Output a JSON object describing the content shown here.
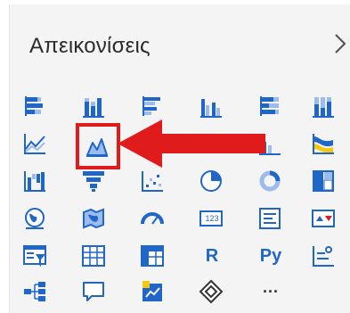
{
  "pane": {
    "title": "Απεικονίσεις",
    "collapse_glyph": ">"
  },
  "icons": [
    {
      "name": "stacked-bar-chart-icon"
    },
    {
      "name": "stacked-column-chart-icon"
    },
    {
      "name": "clustered-bar-chart-icon"
    },
    {
      "name": "clustered-column-chart-icon"
    },
    {
      "name": "100-percent-stacked-bar-chart-icon"
    },
    {
      "name": "100-percent-stacked-column-chart-icon"
    },
    {
      "name": "line-chart-icon"
    },
    {
      "name": "area-chart-icon"
    },
    {
      "name": "stacked-area-chart-icon"
    },
    {
      "name": "line-and-stacked-column-chart-icon"
    },
    {
      "name": "line-and-clustered-column-chart-icon"
    },
    {
      "name": "ribbon-chart-icon"
    },
    {
      "name": "waterfall-chart-icon"
    },
    {
      "name": "funnel-icon"
    },
    {
      "name": "scatter-chart-icon"
    },
    {
      "name": "pie-chart-icon"
    },
    {
      "name": "donut-chart-icon"
    },
    {
      "name": "treemap-icon"
    },
    {
      "name": "map-icon"
    },
    {
      "name": "filled-map-icon"
    },
    {
      "name": "gauge-icon"
    },
    {
      "name": "card-icon",
      "text": "123"
    },
    {
      "name": "multi-row-card-icon"
    },
    {
      "name": "kpi-icon"
    },
    {
      "name": "slicer-icon"
    },
    {
      "name": "table-icon"
    },
    {
      "name": "matrix-icon"
    },
    {
      "name": "r-script-visual-icon",
      "text": "R"
    },
    {
      "name": "python-visual-icon",
      "text": "Py"
    },
    {
      "name": "key-influencers-icon"
    },
    {
      "name": "decomposition-tree-icon"
    },
    {
      "name": "qa-icon"
    },
    {
      "name": "smart-narrative-icon"
    },
    {
      "name": "diamond-icon"
    },
    {
      "name": "more-visuals-icon",
      "text": "···"
    }
  ],
  "colors": {
    "primary": "#1f66c8",
    "accent_yellow": "#f2c811",
    "accent_red": "#e01b1b",
    "pane_bg": "#f4f4f4"
  }
}
